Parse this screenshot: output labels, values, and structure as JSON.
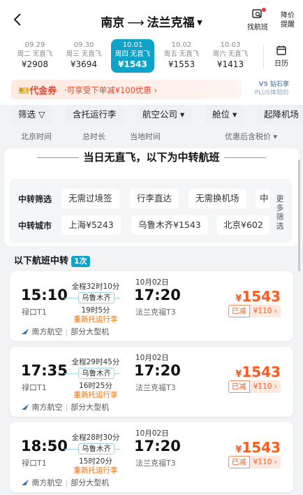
{
  "header": {
    "from": "南京",
    "to": "法兰克福",
    "find_flights": "找航班",
    "price_alert_1": "降价",
    "price_alert_2": "提醒"
  },
  "dates": [
    {
      "date": "09.29",
      "info": "周二 无直飞",
      "price": "¥2908",
      "active": false
    },
    {
      "date": "09.30",
      "info": "周三 无直飞",
      "price": "¥3694",
      "active": false
    },
    {
      "date": "10.01",
      "info": "周四 无直飞",
      "price": "¥1543",
      "active": true
    },
    {
      "date": "10.02",
      "info": "周五 无直飞",
      "price": "¥1553",
      "active": false
    },
    {
      "date": "10.03",
      "info": "周六 无直飞",
      "price": "¥1413",
      "active": false
    }
  ],
  "calendar_label": "日历",
  "coupon": {
    "tag": "代金券",
    "text": "·可享受下单减¥100优惠 ›",
    "plus_line1": "V5 钻石享",
    "plus_line2": "PLUS体验价"
  },
  "filters": [
    "筛选 ▽",
    "含托运行李",
    "航空公司 ▾",
    "舱位 ▾",
    "起降机场"
  ],
  "sorts": {
    "beijing_time": "北京时间",
    "total_duration": "总时长",
    "local_time": "当地时间",
    "price_sort": "优惠后含税价 ▾"
  },
  "no_direct": "当日无直飞，以下为中转航班",
  "transfer": {
    "filter_label": "中转筛选",
    "filter_chips": [
      "无需过境签",
      "行李直达",
      "无需换机场",
      "中"
    ],
    "city_label": "中转城市",
    "city_chips": [
      "上海¥5243",
      "乌鲁木齐¥1543",
      "北京¥602"
    ],
    "more": "更多筛选"
  },
  "transfer_head": "以下航班中转",
  "transfer_badge": "1次",
  "flights": [
    {
      "dep": "15:10",
      "dep_ap": "禄口T1",
      "total": "全程32时10分",
      "via": "乌鲁木齐",
      "wait": "19时5分",
      "recheck": "重新托运行李",
      "arr_date": "10月02日",
      "arr": "17:20",
      "arr_ap": "法兰克福T3",
      "price_y": "¥",
      "price": "1543",
      "cut_a": "已减",
      "cut_b": "¥110 ›",
      "airline": "南方航空",
      "plane": "部分大型机"
    },
    {
      "dep": "17:35",
      "dep_ap": "禄口T1",
      "total": "全程29时45分",
      "via": "乌鲁木齐",
      "wait": "16时25分",
      "recheck": "重新托运行李",
      "arr_date": "10月02日",
      "arr": "17:20",
      "arr_ap": "法兰克福T3",
      "price_y": "¥",
      "price": "1543",
      "cut_a": "已减",
      "cut_b": "¥110 ›",
      "airline": "南方航空",
      "plane": "部分大型机"
    },
    {
      "dep": "18:50",
      "dep_ap": "禄口T1",
      "total": "全程28时30分",
      "via": "乌鲁木齐",
      "wait": "15时20分",
      "recheck": "重新托运行李",
      "arr_date": "10月02日",
      "arr": "17:20",
      "arr_ap": "法兰克福T3",
      "price_y": "¥",
      "price": "1543",
      "cut_a": "已减",
      "cut_b": "¥110 ›",
      "airline": "南方航空",
      "plane": "部分大型机"
    }
  ]
}
